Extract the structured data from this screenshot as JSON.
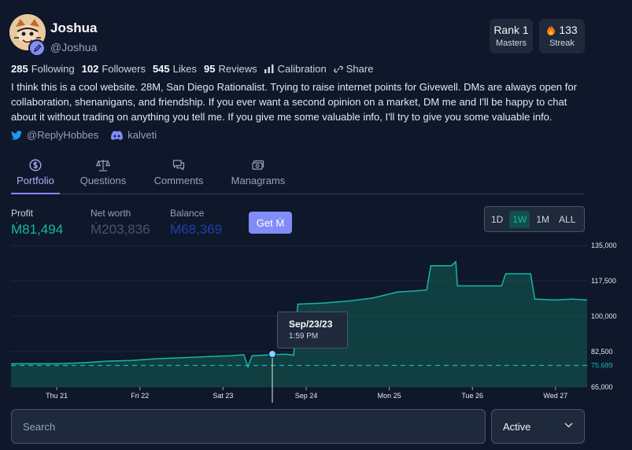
{
  "profile": {
    "name": "Joshua",
    "handle": "@Joshua",
    "avatar_icon": "avatar-image",
    "bio": "I think this is a cool website. 28M, San Diego Rationalist. Trying to raise internet points for Givewell. DMs are always open for collaboration, shenanigans, and friendship. If you ever want a second opinion on a market, DM me and I'll be happy to chat about it without trading on anything you tell me. If you give me some valuable info, I'll try to give you some valuable info."
  },
  "badges": {
    "rank_top": "Rank 1",
    "rank_bottom": "Masters",
    "streak_top": "133",
    "streak_bottom": "Streak"
  },
  "stats": {
    "following_num": "285",
    "following_label": "Following",
    "followers_num": "102",
    "followers_label": "Followers",
    "likes_num": "545",
    "likes_label": "Likes",
    "reviews_num": "95",
    "reviews_label": "Reviews",
    "calibration_label": "Calibration",
    "share_label": "Share"
  },
  "socials": {
    "twitter": "@ReplyHobbes",
    "discord": "kalveti"
  },
  "tabs": [
    {
      "label": "Portfolio",
      "icon": "dollar-circle-icon"
    },
    {
      "label": "Questions",
      "icon": "scale-icon"
    },
    {
      "label": "Comments",
      "icon": "chat-icon"
    },
    {
      "label": "Managrams",
      "icon": "cash-icon"
    }
  ],
  "metrics": {
    "profit_label": "Profit",
    "profit_value": "Ṁ81,494",
    "networth_label": "Net worth",
    "networth_value": "Ṁ203,836",
    "balance_label": "Balance",
    "balance_value": "Ṁ68,369",
    "get_button": "Get Ṁ"
  },
  "ranges": [
    "1D",
    "1W",
    "1M",
    "ALL"
  ],
  "active_range": "1W",
  "colors": {
    "accent": "#818cf8",
    "profit": "#14b8a6",
    "networth": "#475569",
    "balance": "#1e3a8a"
  },
  "tooltip": {
    "date": "Sep/23/23",
    "time": "1:59 PM"
  },
  "search": {
    "placeholder": "Search"
  },
  "filter": {
    "selected": "Active"
  },
  "chart_data": {
    "type": "area",
    "x": [
      "Thu 21",
      "Fri 22",
      "Sat 23",
      "Sep 24",
      "Mon 25",
      "Tue 26",
      "Wed 27"
    ],
    "y_ticks": [
      "135,000",
      "117,500",
      "100,000",
      "82,500",
      "65,000"
    ],
    "ylim": [
      65000,
      135000
    ],
    "baseline": {
      "value": 75689,
      "label": "75,689"
    },
    "series": [
      {
        "values": [
          [
            0,
            76500
          ],
          [
            0.3,
            77000
          ],
          [
            0.6,
            77800
          ],
          [
            0.9,
            78200
          ],
          [
            1.2,
            79000
          ],
          [
            1.5,
            79500
          ],
          [
            1.8,
            80000
          ],
          [
            2.1,
            80500
          ],
          [
            2.25,
            81000
          ],
          [
            2.3,
            75000
          ],
          [
            2.35,
            80500
          ],
          [
            2.6,
            81000
          ],
          [
            2.75,
            81200
          ],
          [
            2.85,
            80800
          ],
          [
            2.9,
            106000
          ],
          [
            3.2,
            106500
          ],
          [
            3.5,
            107500
          ],
          [
            3.8,
            109000
          ],
          [
            4.1,
            112000
          ],
          [
            4.3,
            112500
          ],
          [
            4.45,
            113000
          ],
          [
            4.5,
            125000
          ],
          [
            4.75,
            125000
          ],
          [
            4.8,
            127000
          ],
          [
            4.82,
            115000
          ],
          [
            5.2,
            115000
          ],
          [
            5.35,
            115000
          ],
          [
            5.4,
            121000
          ],
          [
            5.7,
            121000
          ],
          [
            5.75,
            108500
          ],
          [
            6.0,
            108000
          ],
          [
            6.2,
            108500
          ],
          [
            6.38,
            108000
          ]
        ]
      }
    ]
  }
}
